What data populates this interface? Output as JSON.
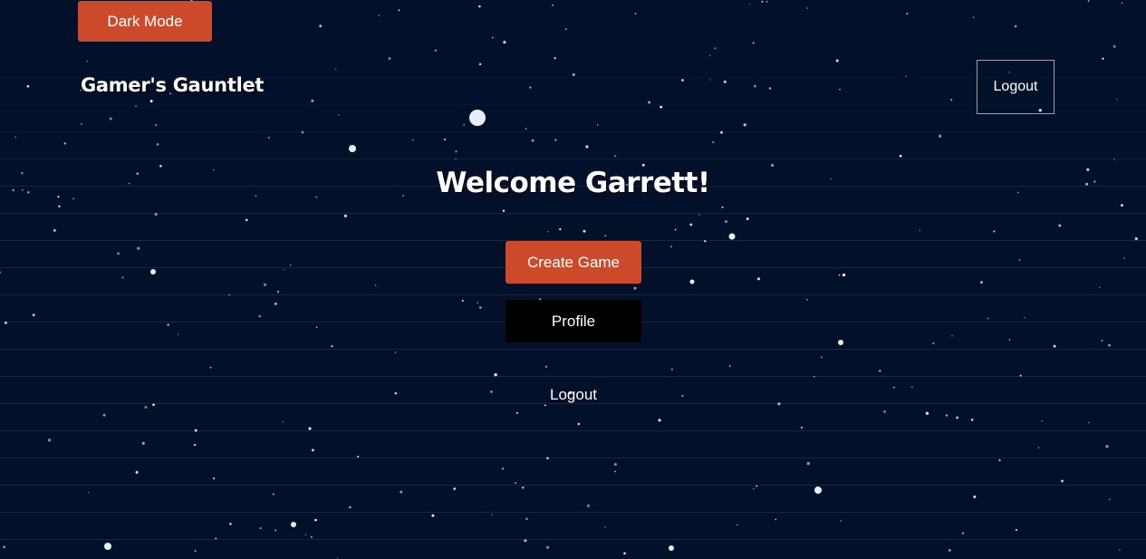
{
  "theme": {
    "background": "#02102a",
    "accent": "#cc4a2a",
    "stripe": "#2d2d82"
  },
  "header": {
    "dark_mode_label": "Dark Mode",
    "brand": "Gamer's Gauntlet",
    "logout_label": "Logout"
  },
  "main": {
    "welcome": "Welcome Garrett!",
    "create_game_label": "Create Game",
    "profile_label": "Profile",
    "logout_label": "Logout"
  }
}
